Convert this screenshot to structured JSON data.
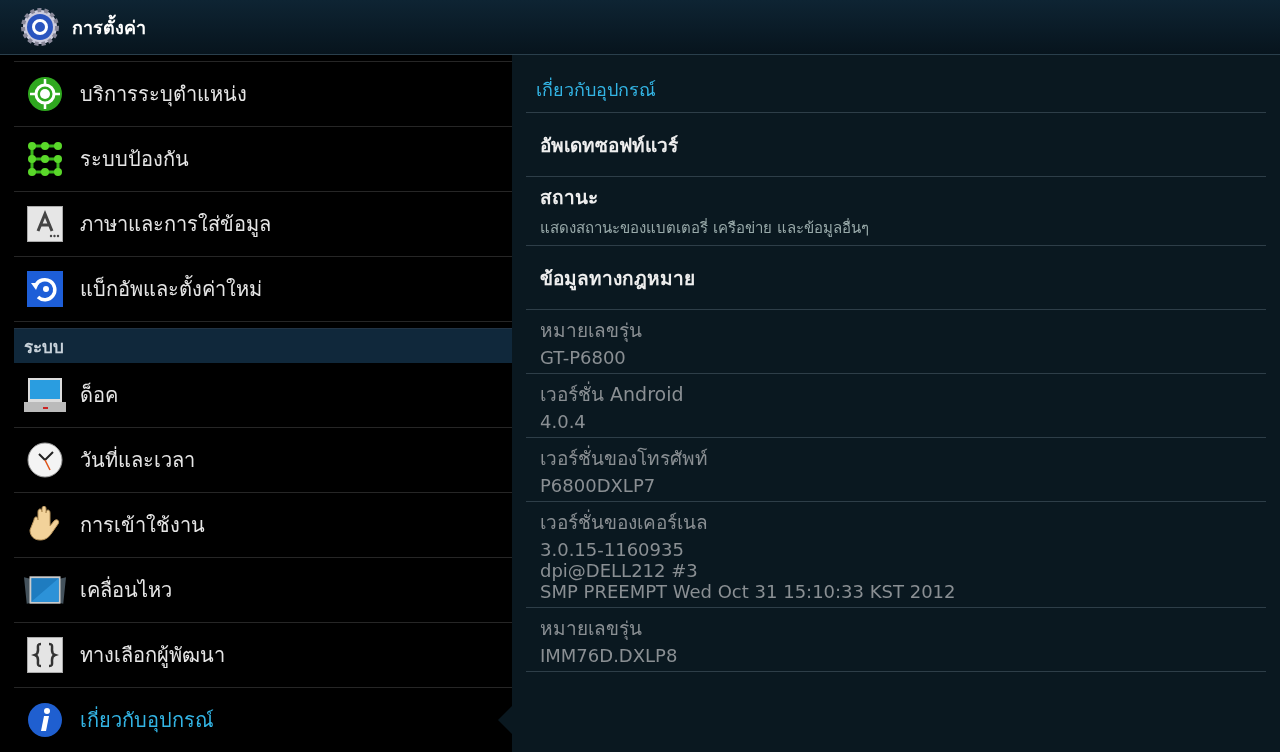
{
  "action_bar": {
    "title": "การตั้งค่า"
  },
  "sidebar": {
    "items": [
      {
        "kind": "location",
        "label": "บริการระบุตำแหน่ง",
        "selected": false
      },
      {
        "kind": "security",
        "label": "ระบบป้องกัน",
        "selected": false
      },
      {
        "kind": "language",
        "label": "ภาษาและการใส่ข้อมูล",
        "selected": false
      },
      {
        "kind": "backup",
        "label": "แบ็กอัพและตั้งค่าใหม่",
        "selected": false
      },
      {
        "kind": "header",
        "label": "ระบบ"
      },
      {
        "kind": "dock",
        "label": "ด็อค",
        "selected": false
      },
      {
        "kind": "clock",
        "label": "วันที่และเวลา",
        "selected": false
      },
      {
        "kind": "hand",
        "label": "การเข้าใช้งาน",
        "selected": false
      },
      {
        "kind": "motion",
        "label": "เคลื่อนไหว",
        "selected": false
      },
      {
        "kind": "developer",
        "label": "ทางเลือกผู้พัฒนา",
        "selected": false
      },
      {
        "kind": "info",
        "label": "เกี่ยวกับอุปกรณ์",
        "selected": true
      }
    ]
  },
  "detail": {
    "title": "เกี่ยวกับอุปกรณ์",
    "items": [
      {
        "title": "อัพเดทซอฟท์แวร์",
        "disabled": false
      },
      {
        "title": "สถานะ",
        "summary": [
          "แสดงสถานะของแบตเตอรี่ เครือข่าย และข้อมูลอื่นๆ"
        ],
        "disabled": false
      },
      {
        "title": "ข้อมูลทางกฎหมาย",
        "disabled": false
      },
      {
        "title": "หมายเลขรุ่น",
        "summary": [
          "GT-P6800"
        ],
        "disabled": true
      },
      {
        "title": "เวอร์ชั่น Android",
        "summary": [
          "4.0.4"
        ],
        "disabled": true
      },
      {
        "title": "เวอร์ชั่นของโทรศัพท์",
        "summary": [
          "P6800DXLP7"
        ],
        "disabled": true
      },
      {
        "title": "เวอร์ชั่นของเคอร์เนล",
        "summary": [
          "3.0.15-1160935",
          "dpi@DELL212 #3",
          "SMP PREEMPT Wed Oct 31 15:10:33 KST 2012"
        ],
        "disabled": true
      },
      {
        "title": "หมายเลขรุ่น",
        "summary": [
          "IMM76D.DXLP8"
        ],
        "disabled": true
      }
    ]
  }
}
